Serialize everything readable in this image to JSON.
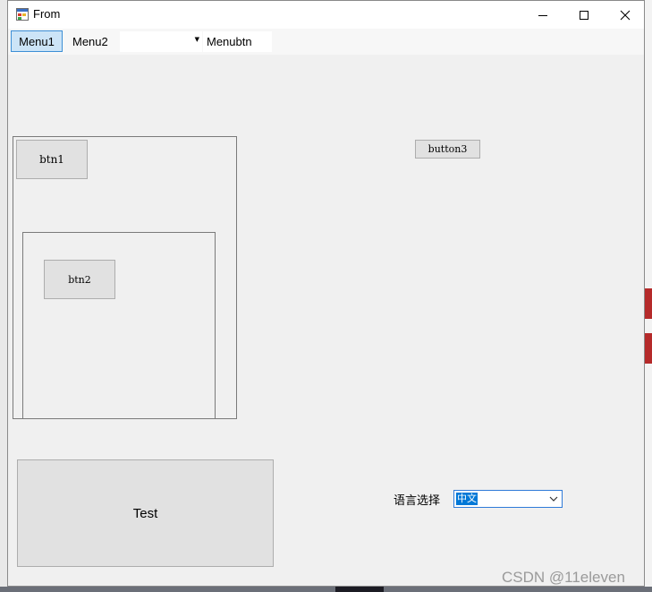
{
  "window": {
    "title": "From",
    "controls": [
      "minimize",
      "maximize",
      "close"
    ]
  },
  "menubar": {
    "items": [
      "Menu1",
      "Menu2"
    ],
    "combo_value": "",
    "menubtn_label": "Menubtn"
  },
  "buttons": {
    "btn1": "btn1",
    "btn2": "btn2",
    "button3": "button3",
    "test": "Test"
  },
  "language": {
    "label": "语言选择",
    "selected": "中文"
  },
  "watermark": "CSDN @11eleven",
  "colors": {
    "menu_selected_bg": "#cce4f7",
    "menu_selected_border": "#3d8fd6",
    "selection_highlight": "#0078d7",
    "form_bg": "#f0f0f0",
    "button_bg": "#e1e1e1"
  }
}
